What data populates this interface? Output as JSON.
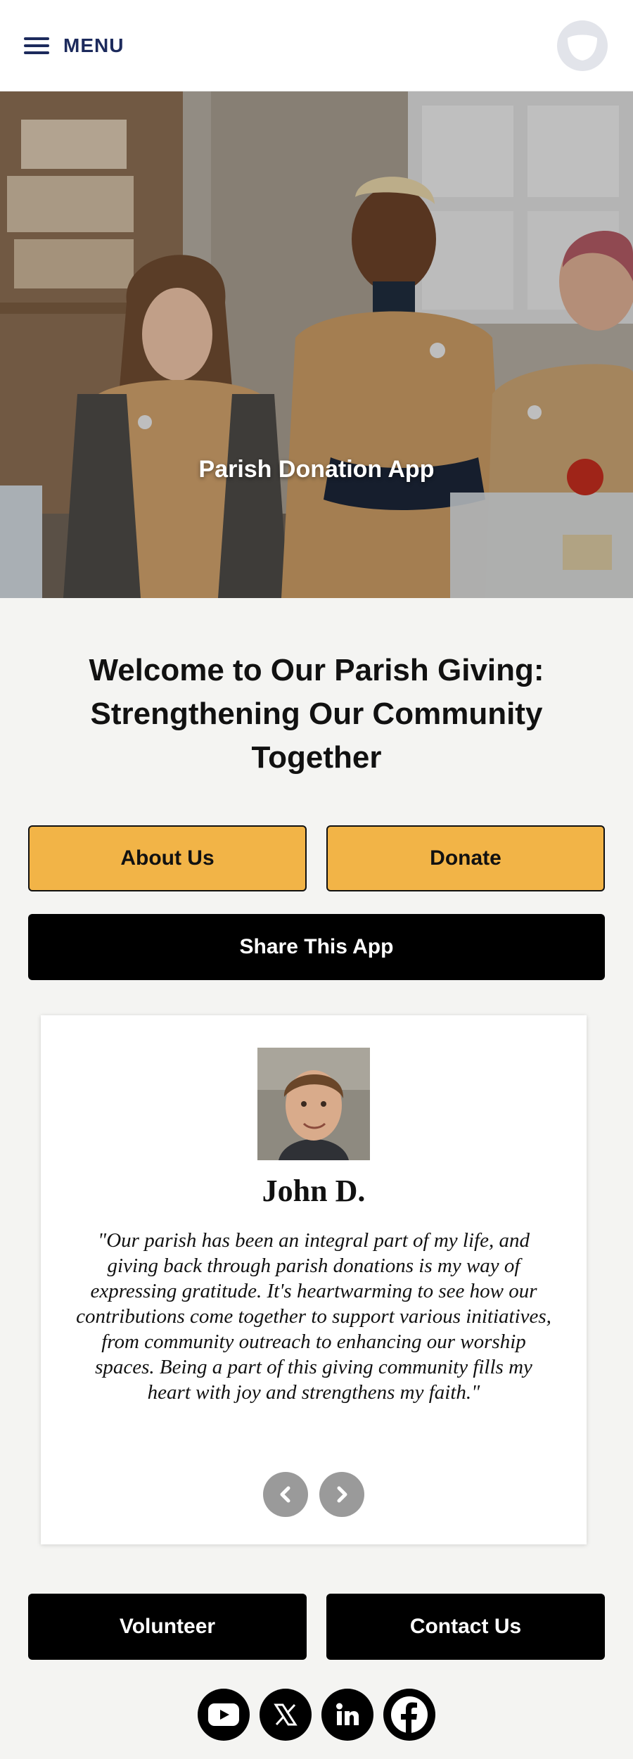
{
  "header": {
    "menu_label": "MENU",
    "logo_icon": "parish-logo-icon"
  },
  "hero": {
    "title": "Parish Donation App"
  },
  "welcome": {
    "heading": "Welcome to Our Parish Giving: Strengthening Our Community Together"
  },
  "buttons": {
    "about": "About Us",
    "donate": "Donate",
    "share": "Share This App",
    "volunteer": "Volunteer",
    "contact": "Contact Us"
  },
  "testimonial": {
    "name": "John D.",
    "quote": "\"Our parish has been an integral part of my life, and giving back through parish donations is my way of expressing gratitude. It's heartwarming to see how our contributions come together to support various initiatives, from community outreach to enhancing our worship spaces. Being a part of this giving community fills my heart with joy and strengthens my faith.\""
  },
  "social": [
    "youtube-icon",
    "x-icon",
    "linkedin-icon",
    "facebook-icon"
  ],
  "colors": {
    "accent": "#f2b447",
    "nav": "#1c2a5c",
    "background": "#f4f4f2",
    "dark": "#000000"
  }
}
